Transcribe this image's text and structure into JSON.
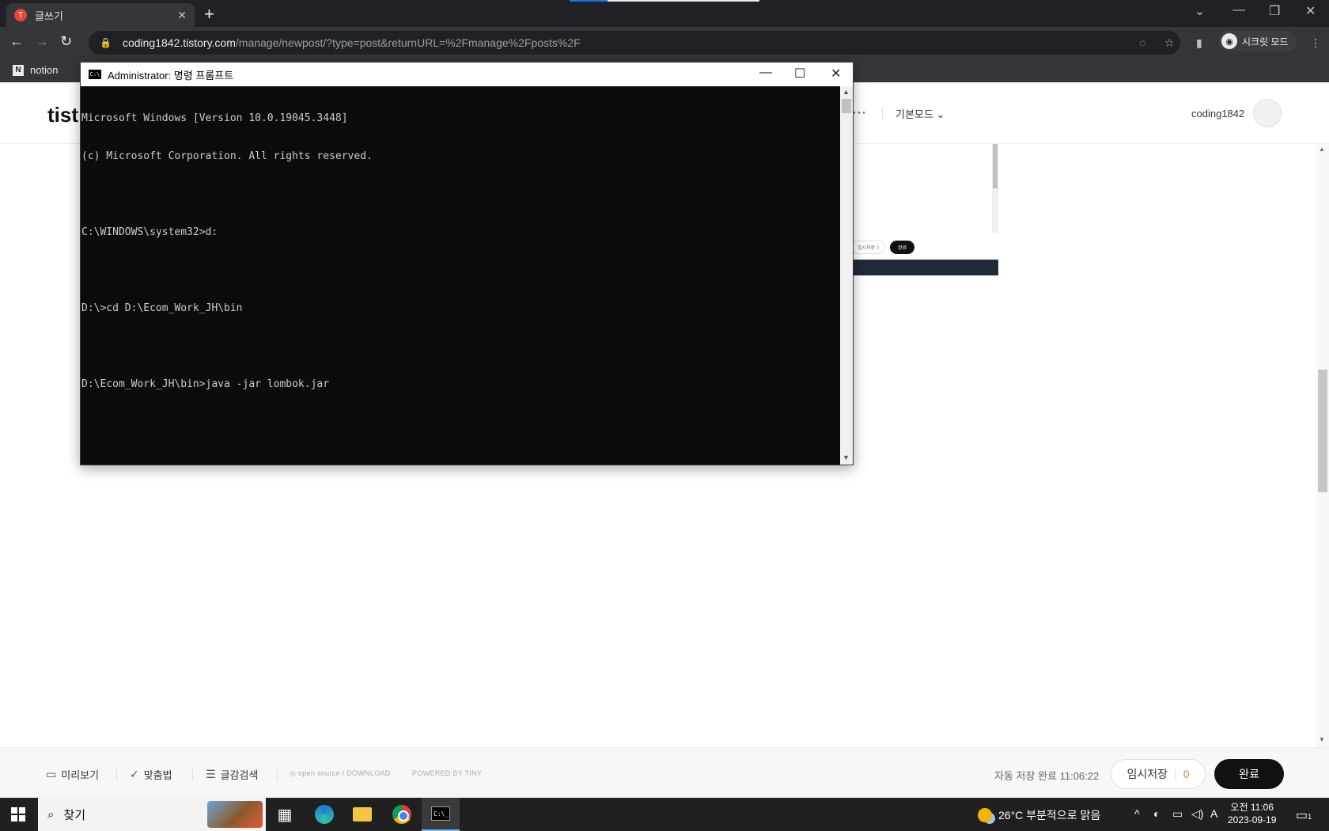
{
  "browser": {
    "tab_title": "글쓰기",
    "tab_favicon": "T",
    "url_host": "coding1842.tistory.com",
    "url_path": "/manage/newpost/?type=post&returnURL=%2Fmanage%2Fposts%2F",
    "incognito_label": "시크릿 모드",
    "bookmarks": [
      {
        "label": "notion"
      }
    ]
  },
  "page": {
    "logo": "tist",
    "mode_label": "기본모드",
    "username": "coding1842"
  },
  "embedded": {
    "temp_save": "임시저장",
    "temp_count": "0",
    "done": "완료"
  },
  "editor_bar": {
    "preview": "미리보기",
    "spellcheck": "맞춤법",
    "content_search": "글감검색",
    "opensource": "open source / DOWNLOAD",
    "powered": "POWERED BY TINY",
    "autosave": "자동 저장 완료 11:06:22",
    "temp_save": "임시저장",
    "temp_count": "0",
    "done": "완료"
  },
  "cmd": {
    "title": "Administrator: 명령 프롬프트",
    "lines": [
      "Microsoft Windows [Version 10.0.19045.3448]",
      "(c) Microsoft Corporation. All rights reserved.",
      "",
      "C:\\WINDOWS\\system32>d:",
      "",
      "D:\\>cd D:\\Ecom_Work_JH\\bin",
      "",
      "D:\\Ecom_Work_JH\\bin>java -jar lombok.jar"
    ]
  },
  "taskbar": {
    "search_placeholder": "찾기",
    "weather": "26°C  부분적으로 맑음",
    "ime": "A",
    "time": "오전 11:06",
    "date": "2023-09-19",
    "notification_count": "1"
  },
  "colors": {
    "chrome_dark": "#202124",
    "chrome_toolbar": "#35363a",
    "accent_orange": "#f27a3e",
    "done_black": "#111111"
  }
}
